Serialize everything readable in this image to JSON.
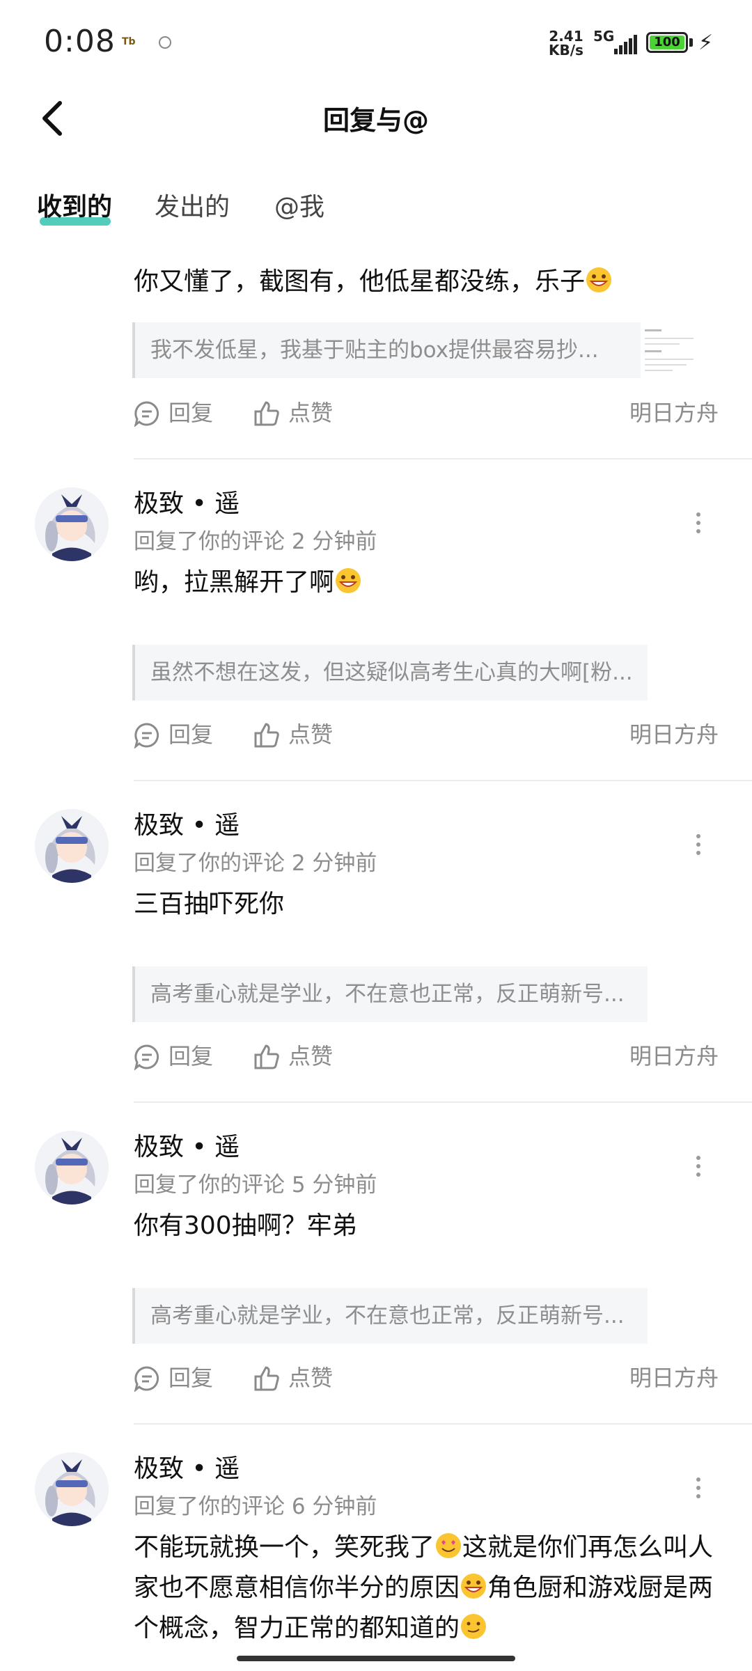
{
  "status_bar": {
    "time": "0:08",
    "speed_top": "2.41",
    "speed_bottom": "KB/s",
    "network": "5G",
    "battery": "100"
  },
  "header": {
    "title": "回复与@"
  },
  "tabs": [
    {
      "label": "收到的"
    },
    {
      "label": "发出的"
    },
    {
      "label": "@我"
    }
  ],
  "actions": {
    "reply": "回复",
    "like": "点赞"
  },
  "items": [
    {
      "content": "你又懂了，截图有，他低星都没练，乐子",
      "quote": "我不发低星，我基于贴主的box提供最容易抄...",
      "tag": "明日方舟"
    },
    {
      "name": "极致 • 遥",
      "meta": "回复了你的评论 2 分钟前",
      "content": "哟，拉黑解开了啊",
      "quote": "虽然不想在这发，但这疑似高考生心真的大啊[粉...",
      "tag": "明日方舟"
    },
    {
      "name": "极致 • 遥",
      "meta": "回复了你的评论 2 分钟前",
      "content": "三百抽吓死你",
      "quote": "高考重心就是学业，不在意也正常，反正萌新号...",
      "tag": "明日方舟"
    },
    {
      "name": "极致 • 遥",
      "meta": "回复了你的评论 5 分钟前",
      "content": "你有300抽啊？牢弟",
      "quote": "高考重心就是学业，不在意也正常，反正萌新号...",
      "tag": "明日方舟"
    },
    {
      "name": "极致 • 遥",
      "meta": "回复了你的评论 6 分钟前",
      "content_parts": [
        "不能玩就换一个，笑死我了",
        "这就是你们再怎么叫人家也不愿意相信你半分的原因",
        "角色厨和游戏厨是两个概念，智力正常的都知道的"
      ]
    }
  ],
  "colors": {
    "accent": "#3fc8b5",
    "battery": "#4cd137"
  }
}
